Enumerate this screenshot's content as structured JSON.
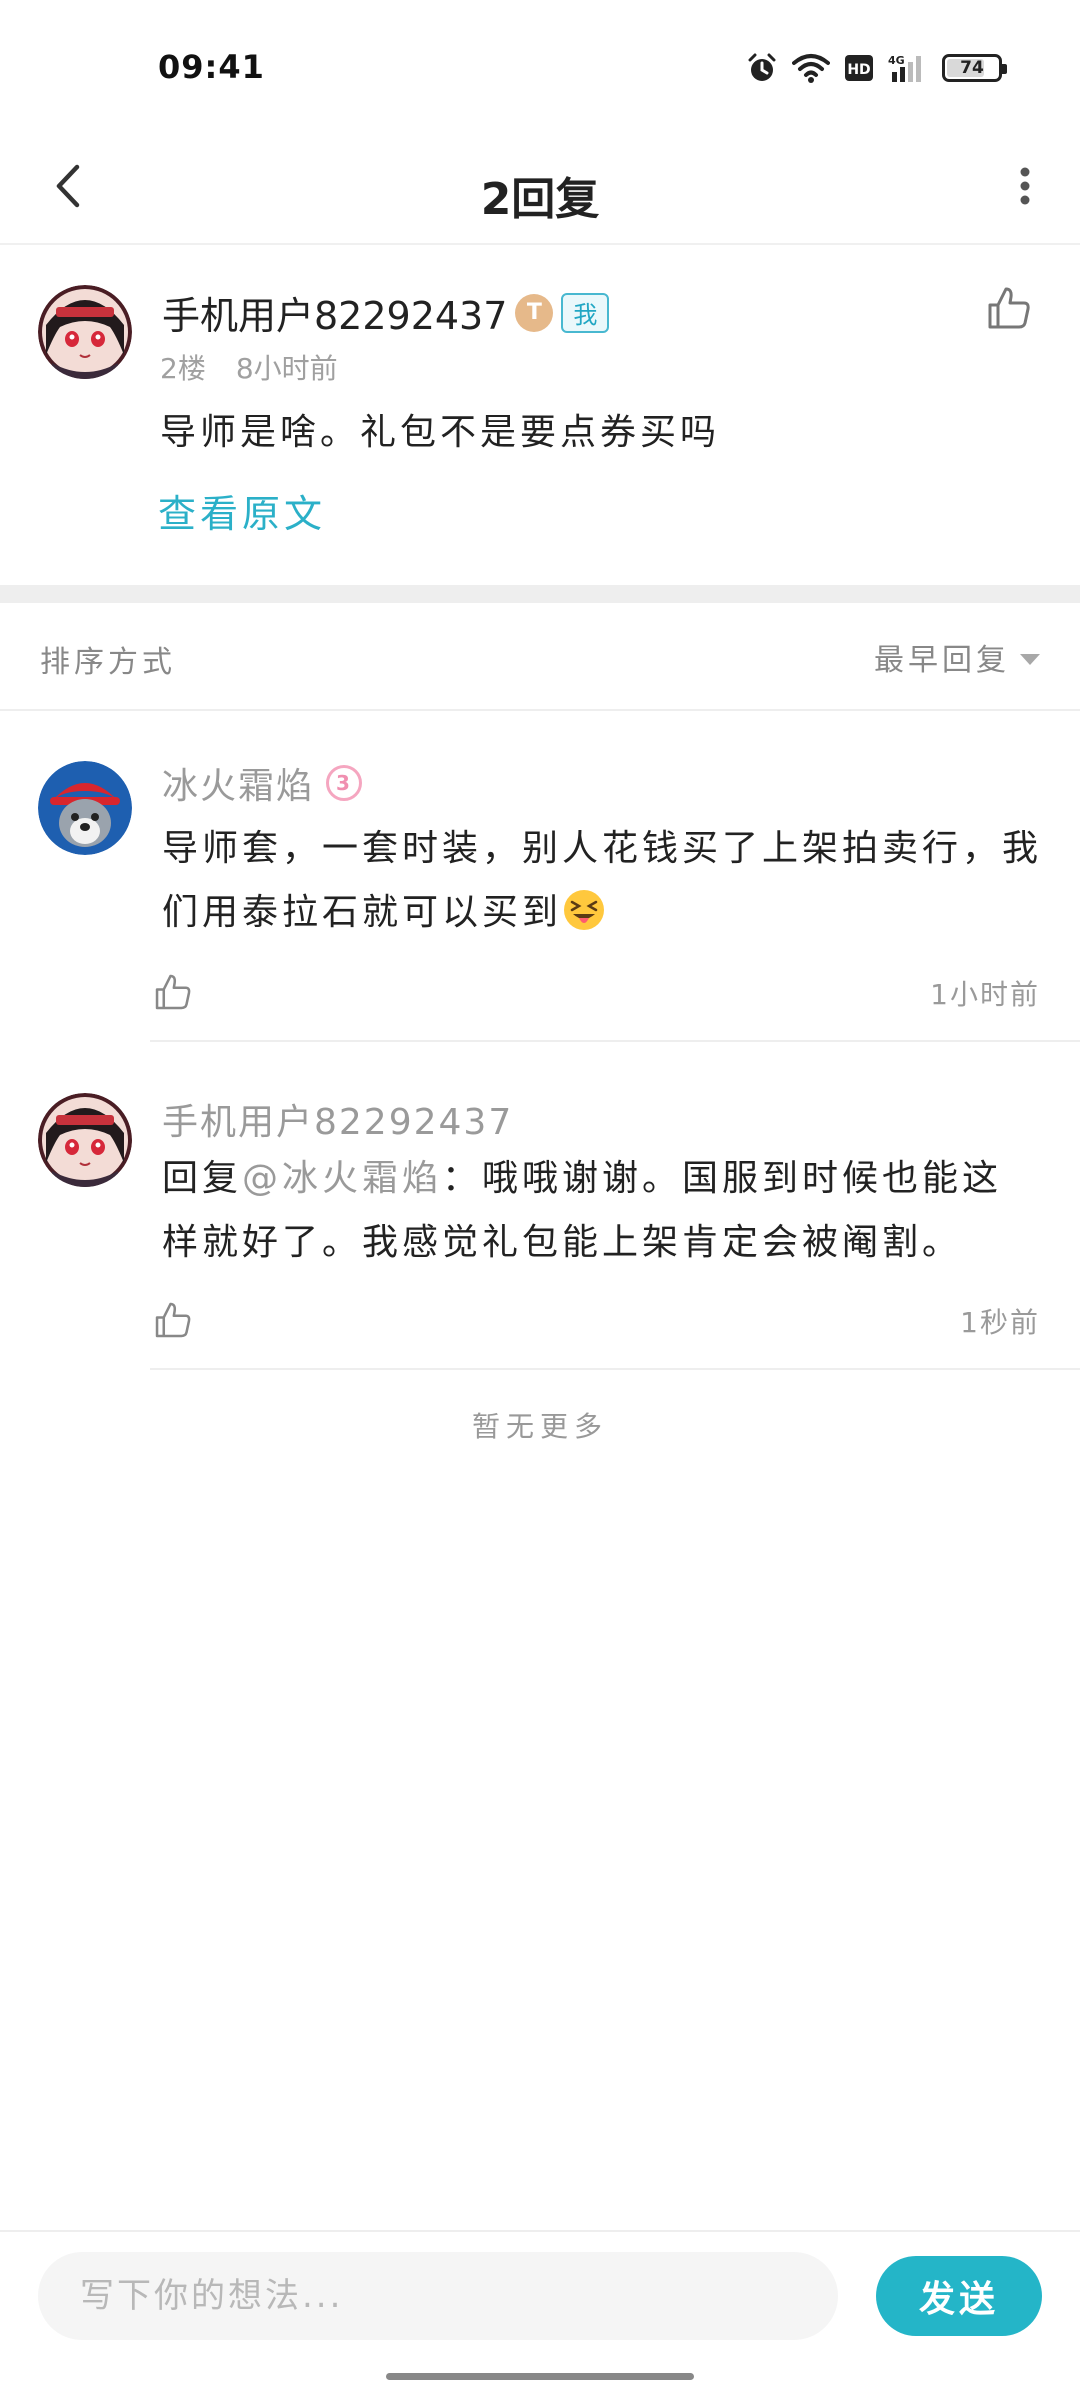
{
  "status_bar": {
    "time": "09:41",
    "battery": "74",
    "battery_level_percent": 74,
    "icons": [
      "alarm-icon",
      "wifi-icon",
      "hd-icon",
      "signal-4g-icon",
      "battery-icon"
    ]
  },
  "header": {
    "title": "2回复",
    "back_icon": "chevron-left-icon",
    "more_icon": "more-vertical-icon"
  },
  "post": {
    "author": "手机用户82292437",
    "level_badge": "T",
    "me_badge": "我",
    "floor": "2楼",
    "time": "8小时前",
    "text": "导师是啥。礼包不是要点券买吗",
    "view_original": "查看原文"
  },
  "sort": {
    "label": "排序方式",
    "selected": "最早回复"
  },
  "replies": [
    {
      "author": "冰火霜焰",
      "badge": "3",
      "text": "导师套，一套时装，别人花钱买了上架拍卖行，我们用泰拉石就可以买到",
      "emoji": "squinting-tongue-emoji",
      "time": "1小时前"
    },
    {
      "author": "手机用户82292437",
      "prefix": "回复",
      "mention": "@冰火霜焰",
      "text": "：哦哦谢谢。国服到时候也能这样就好了。我感觉礼包能上架肯定会被阉割。",
      "time": "1秒前"
    }
  ],
  "no_more": "暂无更多",
  "composer": {
    "placeholder": "写下你的想法...",
    "send_label": "发送"
  },
  "colors": {
    "accent": "#24b5c8",
    "link": "#2bb0c8",
    "muted_text": "#9a9a9a"
  }
}
